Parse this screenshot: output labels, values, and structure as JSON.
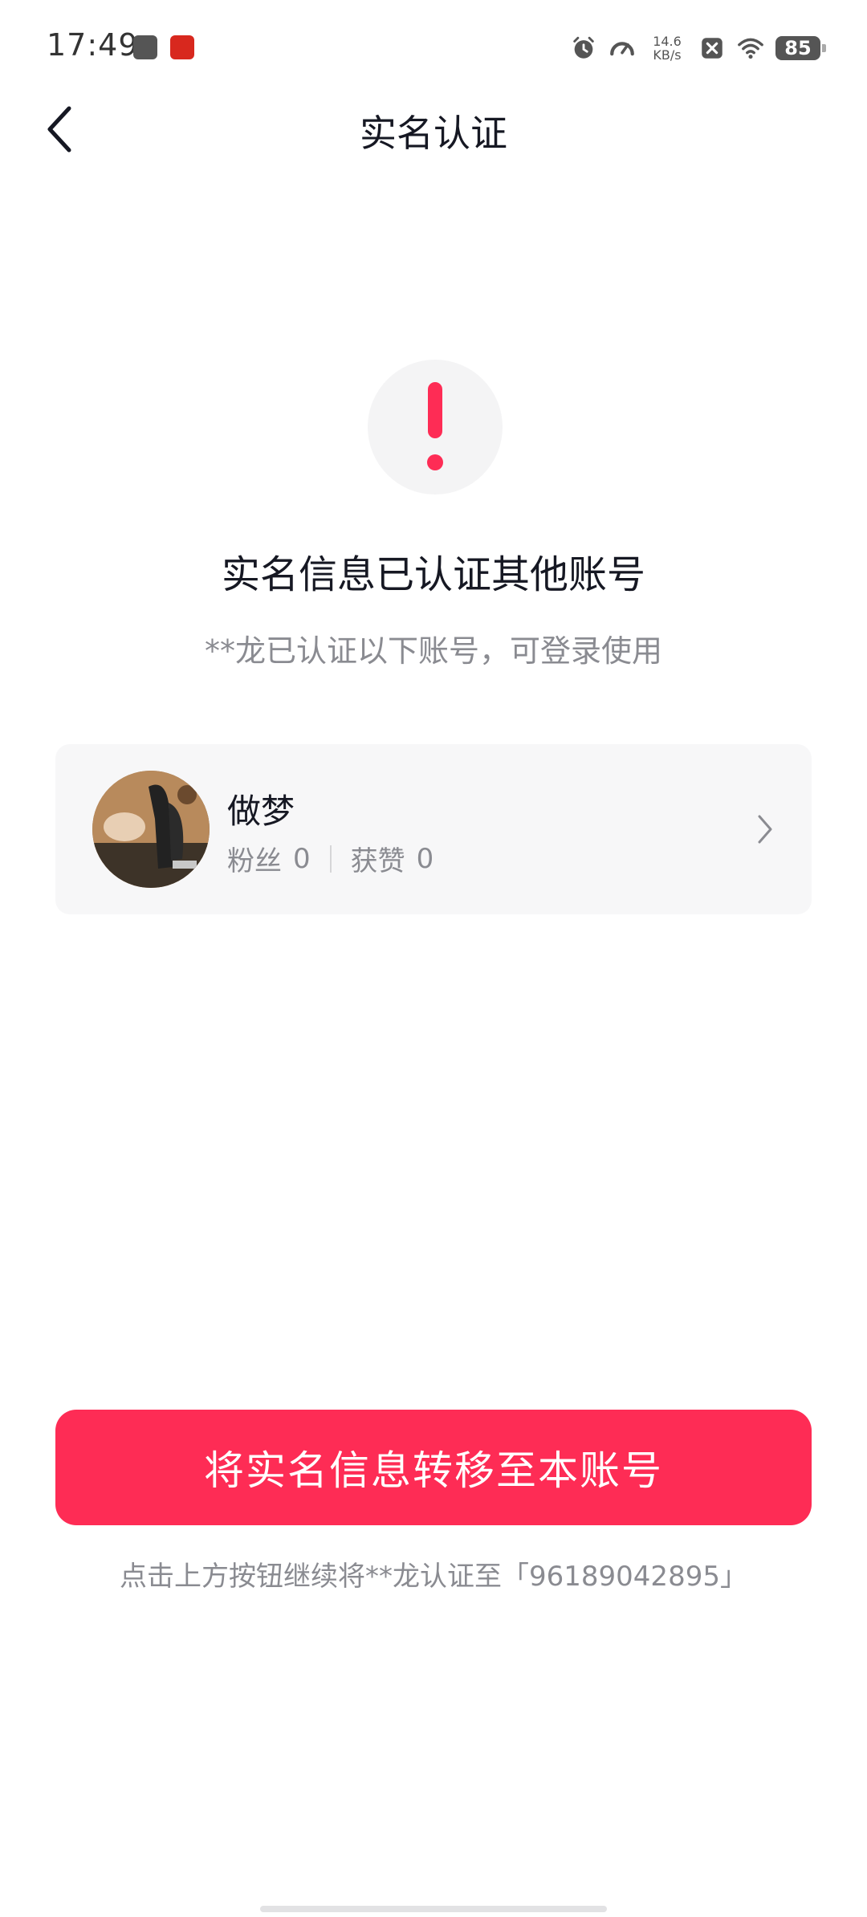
{
  "status_bar": {
    "time": "17:49",
    "net_speed_value": "14.6",
    "net_speed_unit": "KB/s",
    "battery": "85",
    "icons": [
      "message-icon",
      "app-icon",
      "alarm-icon",
      "speedometer-icon",
      "no-sim-icon",
      "wifi-icon",
      "battery-icon"
    ]
  },
  "nav": {
    "title": "实名认证",
    "back_icon": "chevron-left-icon"
  },
  "alert": {
    "icon": "exclamation-icon",
    "color": "#fe2c55"
  },
  "headline": "实名信息已认证其他账号",
  "subhead": "**龙已认证以下账号，可登录使用",
  "account": {
    "name": "做梦",
    "fans_label": "粉丝",
    "fans_count": "0",
    "likes_label": "获赞",
    "likes_count": "0"
  },
  "transfer_button_label": "将实名信息转移至本账号",
  "footnote": "点击上方按钮继续将**龙认证至「96189042895」",
  "colors": {
    "accent": "#fe2c55",
    "text_primary": "#161823",
    "text_secondary": "#8a8b91",
    "card_bg": "#f7f7f8"
  }
}
